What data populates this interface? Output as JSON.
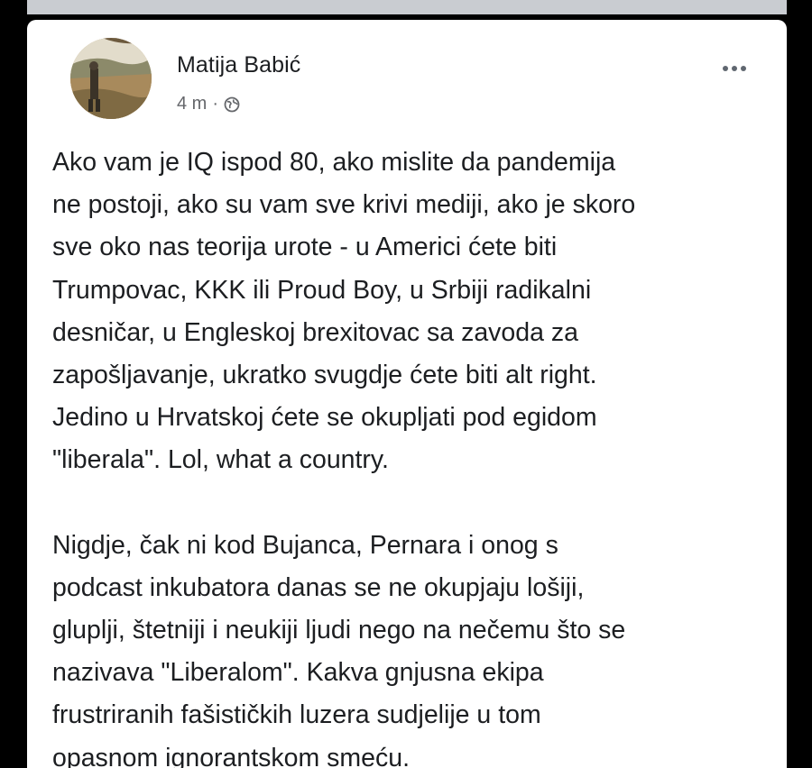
{
  "post": {
    "author": "Matija Babić",
    "time": "4 m",
    "separator": "·",
    "privacy_icon": "globe-icon",
    "more_icon": "more-horizontal-icon",
    "paragraphs": [
      "Ako vam je IQ ispod 80, ako mislite da pandemija\nne postoji, ako su vam sve krivi mediji, ako je skoro\nsve oko nas teorija urote - u Americi ćete biti\nTrumpovac, KKK ili Proud Boy, u Srbiji radikalni\ndesničar, u Engleskoj brexitovac sa zavoda za\nzapošljavanje, ukratko svugdje ćete biti alt right.\nJedino u Hrvatskoj ćete se okupljati pod egidom\n\"liberala\". Lol, what a country.",
      "Nigdje, čak ni kod Bujanca, Pernara i onog s\npodcast inkubatora danas se ne okupjaju lošiji,\ngluplji, štetniji i neukiji ljudi nego na nečemu što se\nnazivava \"Liberalom\". Kakva gnjusna ekipa\nfrustriranih fašističkih luzera sudjelije u tom\nopasnom ignorantskom smeću."
    ]
  },
  "colors": {
    "background": "#000000",
    "card": "#ffffff",
    "text_primary": "#1c1e21",
    "text_secondary": "#65676b"
  }
}
